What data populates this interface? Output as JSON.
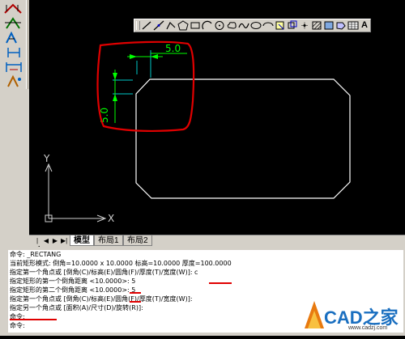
{
  "colors": {
    "canvas_bg": "#000000",
    "geometry": "#ffffff",
    "dimension": "#00ff00",
    "dimension_ext": "#00c8c8",
    "annotation": "#e00000",
    "ucs": "#d0d0d0"
  },
  "left_toolbar": {
    "icons": [
      "linear-dimension-icon",
      "aligned-dimension-icon",
      "radius-dimension-icon",
      "ordinate-dimension-icon",
      "baseline-dimension-icon",
      "continue-dimension-icon"
    ]
  },
  "draw_toolbar": {
    "icons": [
      "line-icon",
      "construction-line-icon",
      "polyline-icon",
      "polygon-icon",
      "rectangle-icon",
      "arc-icon",
      "circle-icon",
      "revision-cloud-icon",
      "spline-icon",
      "ellipse-icon",
      "ellipse-arc-icon",
      "insert-block-icon",
      "make-block-icon",
      "point-icon",
      "hatch-icon",
      "gradient-icon",
      "region-icon",
      "table-icon"
    ],
    "mtext_label": "A"
  },
  "drawing": {
    "dim_horizontal": "5.0",
    "dim_vertical": "5.0",
    "ucs_x_label": "X",
    "ucs_y_label": "Y"
  },
  "tabs": {
    "nav_buttons": [
      "|◀",
      "◀",
      "▶",
      "▶|"
    ],
    "items": [
      {
        "label": "模型",
        "active": true
      },
      {
        "label": "布局1",
        "active": false
      },
      {
        "label": "布局2",
        "active": false
      }
    ]
  },
  "command_history": [
    "命令: _RECTANG",
    "当前矩形模式:  倒角=10.0000 x 10.0000 标高=10.0000 厚度=100.0000",
    "指定第一个角点或 [倒角(C)/标高(E)/圆角(F)/厚度(T)/宽度(W)]: c",
    "指定矩形的第一个倒角距离 <10.0000>: 5",
    "指定矩形的第二个倒角距离 <10.0000>: 5",
    "指定第一个角点或 [倒角(C)/标高(E)/圆角(F)/厚度(T)/宽度(W)]:",
    "指定另一个角点或 [面积(A)/尺寸(D)/旋转(R)]:",
    "命令:",
    "命令:"
  ],
  "watermark": {
    "brand": "CAD之家",
    "url": "www.cadzj.com"
  }
}
